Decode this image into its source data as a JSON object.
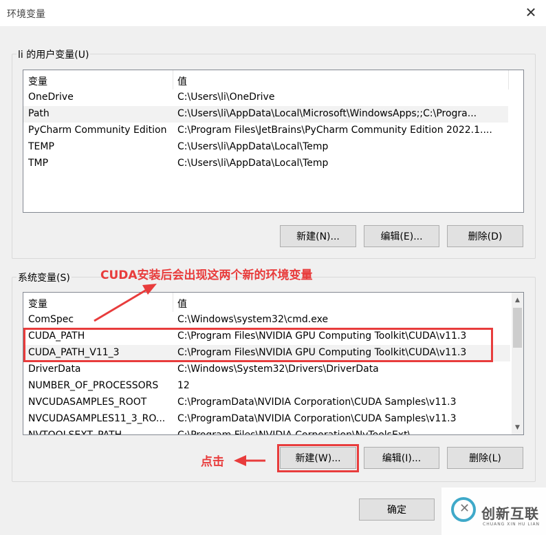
{
  "window": {
    "title": "环境变量",
    "close_symbol": "✕"
  },
  "user_vars": {
    "group_label": "li 的用户变量(U)",
    "headers": [
      "变量",
      "值"
    ],
    "rows": [
      {
        "name": "OneDrive",
        "value": "C:\\Users\\li\\OneDrive"
      },
      {
        "name": "Path",
        "value": "C:\\Users\\li\\AppData\\Local\\Microsoft\\WindowsApps;;C:\\Progra..."
      },
      {
        "name": "PyCharm Community Edition",
        "value": "C:\\Program Files\\JetBrains\\PyCharm Community Edition 2022.1...."
      },
      {
        "name": "TEMP",
        "value": "C:\\Users\\li\\AppData\\Local\\Temp"
      },
      {
        "name": "TMP",
        "value": "C:\\Users\\li\\AppData\\Local\\Temp"
      }
    ],
    "selected_index": 1,
    "buttons": {
      "new": "新建(N)...",
      "edit": "编辑(E)...",
      "delete": "删除(D)"
    }
  },
  "system_vars": {
    "group_label": "系统变量(S)",
    "headers": [
      "变量",
      "值"
    ],
    "rows": [
      {
        "name": "ComSpec",
        "value": "C:\\Windows\\system32\\cmd.exe"
      },
      {
        "name": "CUDA_PATH",
        "value": "C:\\Program Files\\NVIDIA GPU Computing Toolkit\\CUDA\\v11.3"
      },
      {
        "name": "CUDA_PATH_V11_3",
        "value": "C:\\Program Files\\NVIDIA GPU Computing Toolkit\\CUDA\\v11.3"
      },
      {
        "name": "DriverData",
        "value": "C:\\Windows\\System32\\Drivers\\DriverData"
      },
      {
        "name": "NUMBER_OF_PROCESSORS",
        "value": "12"
      },
      {
        "name": "NVCUDASAMPLES_ROOT",
        "value": "C:\\ProgramData\\NVIDIA Corporation\\CUDA Samples\\v11.3"
      },
      {
        "name": "NVCUDASAMPLES11_3_RO...",
        "value": "C:\\ProgramData\\NVIDIA Corporation\\CUDA Samples\\v11.3"
      },
      {
        "name": "NVTOOLSEXT_PATH",
        "value": "C:\\Program Files\\NVIDIA Corporation\\NvToolsExt\\"
      }
    ],
    "selected_index": 2,
    "buttons": {
      "new": "新建(W)...",
      "edit": "编辑(I)...",
      "delete": "删除(L)"
    }
  },
  "footer": {
    "ok": "确定"
  },
  "annotations": {
    "cuda_note": "CUDA安装后会出现这两个新的环境变量",
    "click_note": "点击",
    "color": "#e83c3c"
  },
  "watermark": {
    "cn": "创新互联",
    "en": "CHUANG XIN HU LIAN"
  }
}
